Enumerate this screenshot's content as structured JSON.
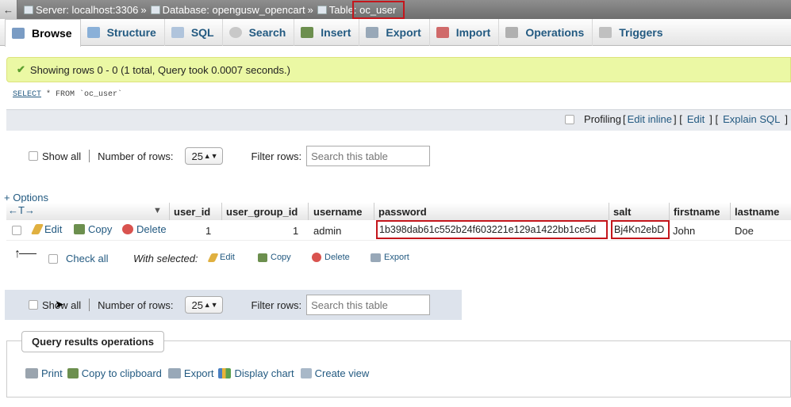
{
  "breadcrumb": {
    "back": "←",
    "server": "Server: localhost:3306",
    "database": "Database: opengusw_opencart",
    "table_prefix": "Table",
    "table": ": oc_user",
    "sep": "»"
  },
  "tabs": [
    {
      "label": "Browse",
      "icon": "browse-icon",
      "color": "#7a9cc4"
    },
    {
      "label": "Structure",
      "icon": "structure-icon",
      "color": "#8ab0d8"
    },
    {
      "label": "SQL",
      "icon": "sql-icon",
      "color": "#b0c4dc"
    },
    {
      "label": "Search",
      "icon": "search-icon",
      "color": "#c8c8c8"
    },
    {
      "label": "Insert",
      "icon": "insert-icon",
      "color": "#6c8f4e"
    },
    {
      "label": "Export",
      "icon": "export-icon",
      "color": "#98a8b8"
    },
    {
      "label": "Import",
      "icon": "import-icon",
      "color": "#d06a6a"
    },
    {
      "label": "Operations",
      "icon": "wrench-icon",
      "color": "#b0b0b0"
    },
    {
      "label": "Triggers",
      "icon": "triggers-icon",
      "color": "#c0c0c0"
    }
  ],
  "success": {
    "text": "Showing rows 0 - 0 (1 total, Query took 0.0007 seconds.)"
  },
  "sql": {
    "keyword": "SELECT",
    "rest": " * FROM `oc_user`"
  },
  "profiling": {
    "label": "Profiling",
    "bracket_open": "[",
    "edit_inline": "Edit inline",
    "sep1": "] [",
    "edit": "Edit",
    "sep2": "] [",
    "explain": "Explain SQL",
    "bracket_close": "]"
  },
  "nav": {
    "show_all": "Show all",
    "num_rows_label": "Number of rows:",
    "num_rows_value": "25",
    "filter_label": "Filter rows:",
    "filter_placeholder": "Search this table"
  },
  "options": {
    "label": "+ Options",
    "arrows": "←T→"
  },
  "columns": [
    "user_id",
    "user_group_id",
    "username",
    "password",
    "salt",
    "firstname",
    "lastname"
  ],
  "row": {
    "actions": {
      "edit": "Edit",
      "copy": "Copy",
      "delete": "Delete"
    },
    "user_id": "1",
    "user_group_id": "1",
    "username": "admin",
    "password": "1b398dab61c552b24f603221e129a1422bb1ce5d",
    "salt": "Bj4Kn2ebD",
    "firstname": "John",
    "lastname": "Doe"
  },
  "with_selected": {
    "check_all": "Check all",
    "label": "With selected:",
    "edit": "Edit",
    "copy": "Copy",
    "delete": "Delete",
    "export": "Export"
  },
  "query_ops": {
    "title": "Query results operations",
    "print": "Print",
    "copy": "Copy to clipboard",
    "export": "Export",
    "chart": "Display chart",
    "view": "Create view"
  },
  "colors": {
    "highlight": "#c4161c",
    "link": "#235a81",
    "success_bg": "#ebf8a4"
  }
}
